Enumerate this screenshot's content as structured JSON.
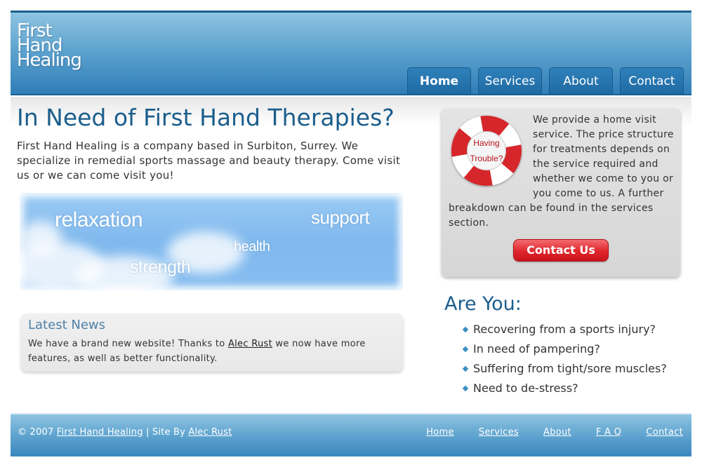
{
  "logo": {
    "lines": [
      "First",
      "Hand",
      "Healing"
    ]
  },
  "nav": {
    "items": [
      {
        "label": "Home"
      },
      {
        "label": "Services"
      },
      {
        "label": "About"
      },
      {
        "label": "Contact"
      }
    ]
  },
  "main": {
    "heading": "In Need of First Hand Therapies?",
    "intro": "First Hand Healing is a company based in Surbiton, Surrey. We specialize in remedial sports massage and beauty therapy. Come visit us or we can come visit you!"
  },
  "banner": {
    "words": [
      "relaxation",
      "support",
      "health",
      "strength"
    ]
  },
  "news": {
    "title": "Latest News",
    "text_before": "We have a brand new website! Thanks to ",
    "link": "Alec Rust",
    "text_after": " we now have more features, as well as better functionality."
  },
  "trouble": {
    "ring_line1": "Having",
    "ring_line2": "Trouble?",
    "text": "We provide a home visit service. The price structure for treatments depends on the service required and whether we come to you or you come to us. A further breakdown can be found in the services section.",
    "button": "Contact Us"
  },
  "are_you": {
    "heading": "Are You:",
    "items": [
      "Recovering from a sports injury?",
      "In need of pampering?",
      "Suffering from tight/sore muscles?",
      "Need to de-stress?"
    ]
  },
  "footer": {
    "copyright": "© 2007",
    "company_link": "First Hand Healing",
    "separator": " | Site By ",
    "author_link": "Alec Rust",
    "nav": [
      "Home",
      "Services",
      "About",
      "F A Q",
      "Contact"
    ]
  },
  "colors": {
    "header_blue": "#2f7db8",
    "heading_blue": "#1b5e8c",
    "button_red": "#e0262c"
  }
}
